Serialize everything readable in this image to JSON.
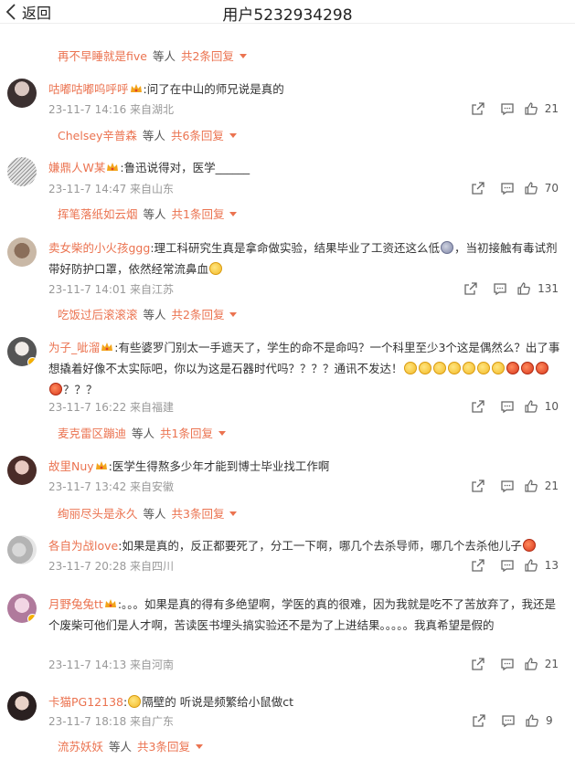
{
  "header": {
    "back_label": "返回",
    "title": "用户5232934298"
  },
  "top_reply": {
    "user": "再不早睡就是five",
    "deng": "等人",
    "count": "共2条回复"
  },
  "comments": [
    {
      "user": "咕嘟咕嘟呜呼呼",
      "text_pre": ":问了在中山的师兄说是真的",
      "text": "",
      "date": "23-11-7 14:16 来自湖北",
      "likes": "21",
      "reply": {
        "user": "Chelsey辛普森",
        "deng": "等人",
        "count": "共6条回复"
      }
    },
    {
      "user": "嫌鼎人W某",
      "text_pre": ":鲁迅说得对，医学______",
      "text": "",
      "date": "23-11-7 14:47 来自山东",
      "likes": "70",
      "reply": {
        "user": "挥笔落纸如云烟",
        "deng": "等人",
        "count": "共1条回复"
      }
    },
    {
      "user": "卖女柴的小火孩ggg",
      "text_pre": ":理工科研究生真是拿命做实验，结果毕业了工资还这么低",
      "text": "，当初接触有毒试剂带好防护口罩，依然经常流鼻血",
      "date": "23-11-7 14:01 来自江苏",
      "likes": "131",
      "reply": {
        "user": "吃饭过后滚滚滚",
        "deng": "等人",
        "count": "共2条回复"
      }
    },
    {
      "user": "为子_呲溜",
      "text_pre": ":有些婆罗门别太一手遮天了，学生的命不是命吗？一个科里至少3个这是偶然么？出了事想撬着好像不太实际吧，你以为这是石器时代吗？？？？通讯不发达！",
      "text": "？？？",
      "date": "23-11-7 16:22 来自福建",
      "likes": "10",
      "reply": {
        "user": "麦克雷区蹦迪",
        "deng": "等人",
        "count": "共1条回复"
      }
    },
    {
      "user": "故里Nuy",
      "text_pre": ":医学生得熬多少年才能到博士毕业找工作啊",
      "text": "",
      "date": "23-11-7 13:42 来自安徽",
      "likes": "21",
      "reply": {
        "user": "绚丽尽头是永久",
        "deng": "等人",
        "count": "共3条回复"
      }
    },
    {
      "user": "各自为战love",
      "text_pre": ":如果是真的，反正都要死了，分工一下啊，哪几个去杀导师，哪几个去杀他儿子",
      "text": "",
      "date": "23-11-7 20:28 来自四川",
      "likes": "13",
      "reply": null
    },
    {
      "user": "月野兔兔tt",
      "text_pre": ":。。。如果是真的得有多绝望啊，学医的真的很难，因为我就是吃不了苦放弃了，我还是个废柴可他们是人才啊，苦读医书埋头搞实验还不是为了上进结果。。。。。我真希望是假的",
      "text": "",
      "date": "23-11-7 14:13 来自河南",
      "likes": "21",
      "reply": null
    },
    {
      "user": "卡猫PG12138",
      "text_pre": ":",
      "text": "隔壁的 听说是频繁给小鼠做ct",
      "date": "23-11-7 18:18 来自广东",
      "likes": "9",
      "reply": {
        "user": "流苏妖妖",
        "deng": "等人",
        "count": "共3条回复"
      }
    }
  ],
  "colors": {
    "accent": "#eb7350",
    "meta": "#999999",
    "text": "#333333"
  }
}
